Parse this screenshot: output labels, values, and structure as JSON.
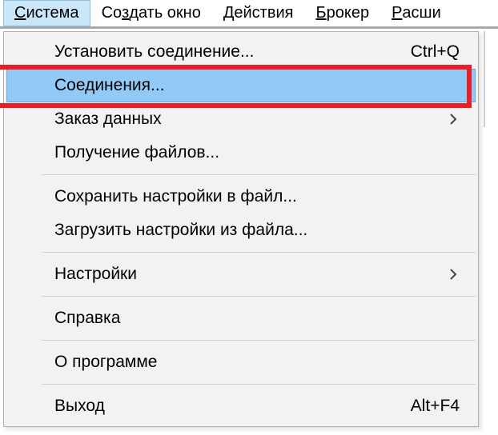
{
  "menubar": {
    "items": [
      {
        "prefix": "",
        "mnemonic": "С",
        "rest": "истема",
        "active": true
      },
      {
        "prefix": "Со",
        "mnemonic": "з",
        "rest": "дать окно",
        "active": false
      },
      {
        "prefix": "",
        "mnemonic": "Д",
        "rest": "ействия",
        "active": false
      },
      {
        "prefix": "",
        "mnemonic": "Б",
        "rest": "рокер",
        "active": false
      },
      {
        "prefix": "",
        "mnemonic": "Р",
        "rest": "асши",
        "active": false
      }
    ]
  },
  "dropdown": {
    "items": [
      {
        "type": "item",
        "label": "Установить соединение...",
        "accel": "Ctrl+Q",
        "submenu": false,
        "highlighted": false,
        "framed": false
      },
      {
        "type": "item",
        "label": "Соединения...",
        "accel": "",
        "submenu": false,
        "highlighted": true,
        "framed": true
      },
      {
        "type": "item",
        "label": "Заказ данных",
        "accel": "",
        "submenu": true
      },
      {
        "type": "item",
        "label": "Получение файлов...",
        "accel": "",
        "submenu": false
      },
      {
        "type": "separator"
      },
      {
        "type": "item",
        "label": "Сохранить настройки в файл...",
        "accel": "",
        "submenu": false
      },
      {
        "type": "item",
        "label": "Загрузить настройки из файла...",
        "accel": "",
        "submenu": false
      },
      {
        "type": "separator"
      },
      {
        "type": "item",
        "label": "Настройки",
        "accel": "",
        "submenu": true
      },
      {
        "type": "separator"
      },
      {
        "type": "item",
        "label": "Справка",
        "accel": "",
        "submenu": false
      },
      {
        "type": "separator"
      },
      {
        "type": "item",
        "label": "О программе",
        "accel": "",
        "submenu": false
      },
      {
        "type": "separator"
      },
      {
        "type": "item",
        "label": "Выход",
        "accel": "Alt+F4",
        "submenu": false
      }
    ]
  }
}
